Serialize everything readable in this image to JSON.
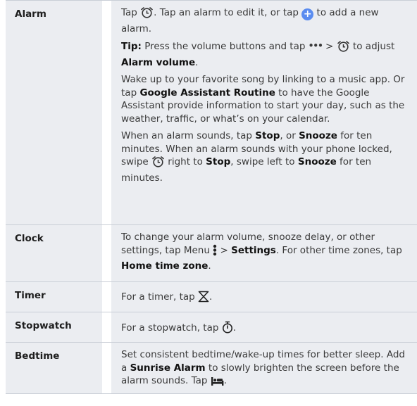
{
  "rows": [
    {
      "label": "Alarm",
      "p1": {
        "a": "Tap ",
        "b": ". Tap an alarm to edit it, or tap ",
        "c": " to add a new alarm."
      },
      "p2": {
        "tip": "Tip:",
        "a": " Press the volume buttons and tap ",
        "b": " > ",
        "c": " to adjust ",
        "bold": "Alarm volume",
        "d": "."
      },
      "p3": {
        "a": "Wake up to your favorite song by linking to a music app. Or tap ",
        "bold": "Google Assistant Routine",
        "b": " to have the Google Assistant provide information to start your day, such as the weather, traffic, or what’s on your calendar."
      },
      "p4": {
        "a": "When an alarm sounds, tap ",
        "stop": "Stop",
        "b": ", or ",
        "snooze": "Snooze",
        "c": " for ten minutes. When an alarm sounds with your phone locked, swipe ",
        "d": " right to ",
        "stop2": "Stop",
        "e": ", swipe left to ",
        "snooze2": "Snooze",
        "f": " for ten minutes."
      }
    },
    {
      "label": "Clock",
      "a": "To change your alarm volume, snooze delay, or other settings, tap Menu ",
      "b": " > ",
      "settings": "Settings",
      "c": ". For other time zones, tap ",
      "home": "Home time zone",
      "d": "."
    },
    {
      "label": "Timer",
      "a": "For a timer, tap ",
      "b": "."
    },
    {
      "label": "Stopwatch",
      "a": "For a stopwatch, tap ",
      "b": "."
    },
    {
      "label": "Bedtime",
      "a": "Set consistent bedtime/wake-up times for better sleep. Add a ",
      "bold": "Sunrise Alarm",
      "b": " to slowly brighten the screen before the alarm sounds. Tap ",
      "c": "."
    }
  ],
  "icons": {
    "alarm": "alarm-clock-icon",
    "add": "plus-circle-icon",
    "more": "more-dots-icon",
    "menu": "vertical-dots-menu-icon",
    "timer": "hourglass-icon",
    "stopwatch": "stopwatch-icon",
    "bedtime": "bed-icon",
    "plus_glyph": "+",
    "dots_glyph": "•••"
  },
  "colors": {
    "row_bg": "#ebedf1",
    "accent": "#5a8cf0",
    "border": "#c9ced6"
  }
}
